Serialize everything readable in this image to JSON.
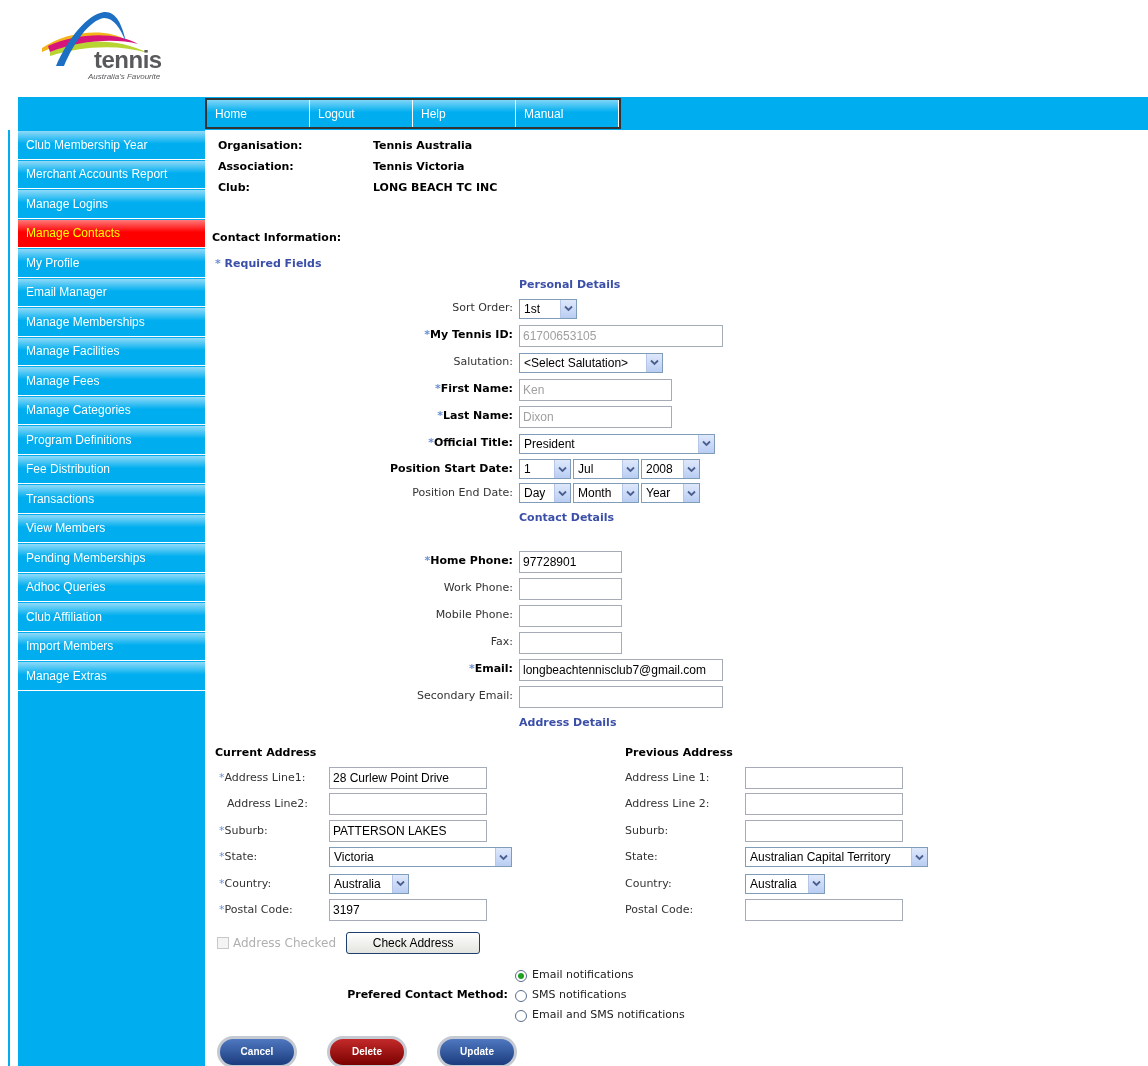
{
  "logo": {
    "name": "tennis",
    "tagline": "Australia's Favourite"
  },
  "nav": [
    {
      "label": "Home"
    },
    {
      "label": "Logout"
    },
    {
      "label": "Help"
    },
    {
      "label": "Manual"
    }
  ],
  "sidebar": {
    "items": [
      {
        "label": "Club Membership Year",
        "selected": false
      },
      {
        "label": "Merchant Accounts Report",
        "selected": false
      },
      {
        "label": "Manage Logins",
        "selected": false
      },
      {
        "label": "Manage Contacts",
        "selected": true
      },
      {
        "label": "My Profile",
        "selected": false
      },
      {
        "label": "Email Manager",
        "selected": false
      },
      {
        "label": "Manage Memberships",
        "selected": false
      },
      {
        "label": "Manage Facilities",
        "selected": false
      },
      {
        "label": "Manage Fees",
        "selected": false
      },
      {
        "label": "Manage Categories",
        "selected": false
      },
      {
        "label": "Program Definitions",
        "selected": false
      },
      {
        "label": "Fee Distribution",
        "selected": false
      },
      {
        "label": "Transactions",
        "selected": false
      },
      {
        "label": "View Members",
        "selected": false
      },
      {
        "label": "Pending Memberships",
        "selected": false
      },
      {
        "label": "Adhoc Queries",
        "selected": false
      },
      {
        "label": "Club Affiliation",
        "selected": false
      },
      {
        "label": "Import Members",
        "selected": false
      },
      {
        "label": "Manage Extras",
        "selected": false
      }
    ]
  },
  "org_info": [
    {
      "label": "Organisation:",
      "value": "Tennis Australia"
    },
    {
      "label": "Association:",
      "value": "Tennis Victoria"
    },
    {
      "label": "Club:",
      "value": "LONG BEACH TC INC"
    }
  ],
  "contact_heading": "Contact Information:",
  "required_note": {
    "mark": "*",
    "text": "Required Fields"
  },
  "sections": [
    {
      "heading": "Personal Details",
      "fields": [
        {
          "label": "Sort Order:",
          "required": false,
          "bold": false,
          "kind": "select",
          "value": "1st"
        },
        {
          "label": "My Tennis ID:",
          "required": true,
          "bold": true,
          "kind": "text",
          "value": "61700653105",
          "disabled": true
        },
        {
          "label": "Salutation:",
          "required": false,
          "bold": false,
          "kind": "select",
          "value": "<Select Salutation>"
        },
        {
          "label": "First Name:",
          "required": true,
          "bold": true,
          "kind": "text",
          "value": "Ken",
          "disabled": true
        },
        {
          "label": "Last Name:",
          "required": true,
          "bold": true,
          "kind": "text",
          "value": "Dixon",
          "disabled": true
        },
        {
          "label": "Official Title:",
          "required": true,
          "bold": true,
          "kind": "select",
          "value": "President"
        },
        {
          "label": "Position Start Date:",
          "required": false,
          "bold": true,
          "kind": "date",
          "parts": [
            "1",
            "Jul",
            "2008"
          ]
        },
        {
          "label": "Position End Date:",
          "required": false,
          "bold": false,
          "kind": "date",
          "parts": [
            "Day",
            "Month",
            "Year"
          ]
        }
      ]
    },
    {
      "heading": "Contact Details",
      "fields": [
        {
          "label": "Home Phone:",
          "required": true,
          "bold": true,
          "kind": "text",
          "value": "97728901",
          "disabled": false
        },
        {
          "label": "Work Phone:",
          "required": false,
          "bold": false,
          "kind": "text"
        },
        {
          "label": "Mobile Phone:",
          "required": false,
          "bold": false,
          "kind": "text"
        },
        {
          "label": "Fax:",
          "required": false,
          "bold": false,
          "kind": "text"
        },
        {
          "label": "Email:",
          "required": true,
          "bold": true,
          "kind": "text",
          "value": "longbeachtennisclub7@gmail.com",
          "disabled": false
        },
        {
          "label": "Secondary Email:",
          "required": false,
          "bold": false,
          "kind": "text"
        }
      ]
    },
    {
      "heading": "Address Details"
    }
  ],
  "addresses": [
    {
      "title": "Current Address",
      "fields": [
        {
          "label": "Address Line1:",
          "required": true,
          "kind": "text",
          "value": "28 Curlew Point Drive"
        },
        {
          "label": "Address Line2:",
          "required": false,
          "kind": "text"
        },
        {
          "label": "Suburb:",
          "required": true,
          "kind": "text",
          "value": "PATTERSON LAKES"
        },
        {
          "label": "State:",
          "required": true,
          "kind": "select",
          "value": "Victoria"
        },
        {
          "label": "Country:",
          "required": true,
          "kind": "select",
          "value": "Australia"
        },
        {
          "label": "Postal Code:",
          "required": true,
          "kind": "text",
          "value": "3197"
        }
      ]
    },
    {
      "title": "Previous Address",
      "fields": [
        {
          "label": "Address Line 1:",
          "required": false,
          "kind": "text"
        },
        {
          "label": "Address Line 2:",
          "required": false,
          "kind": "text"
        },
        {
          "label": "Suburb:",
          "required": false,
          "kind": "text"
        },
        {
          "label": "State:",
          "required": false,
          "kind": "select",
          "value": "Australian Capital Territory"
        },
        {
          "label": "Country:",
          "required": false,
          "kind": "select",
          "value": "Australia"
        },
        {
          "label": "Postal Code:",
          "required": false,
          "kind": "text"
        }
      ]
    }
  ],
  "address_checked": {
    "label": "Address Checked",
    "checked": false,
    "disabled": true
  },
  "check_address_button": "Check Address",
  "contact_method": {
    "label": "Prefered Contact Method:",
    "options": [
      {
        "label": "Email notifications",
        "selected": true
      },
      {
        "label": "SMS notifications",
        "selected": false
      },
      {
        "label": "Email and SMS notifications",
        "selected": false
      }
    ]
  },
  "buttons": [
    {
      "label": "Cancel",
      "kind": "primary"
    },
    {
      "label": "Delete",
      "kind": "danger"
    },
    {
      "label": "Update",
      "kind": "primary"
    }
  ]
}
